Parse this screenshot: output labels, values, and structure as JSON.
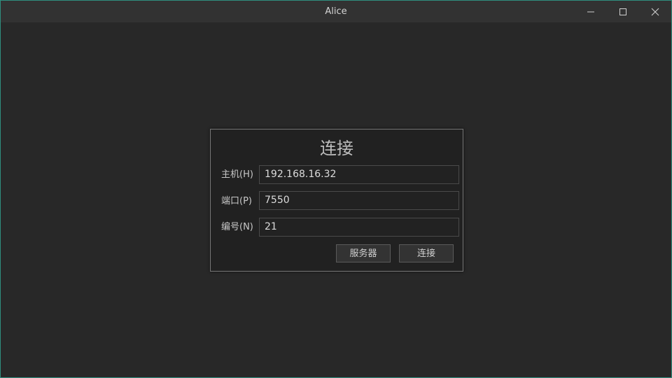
{
  "window": {
    "title": "Alice",
    "accent_border_color": "#2f8f7f",
    "controls": {
      "minimize_icon": "minimize-icon",
      "maximize_icon": "maximize-icon",
      "close_icon": "close-icon"
    }
  },
  "dialog": {
    "title": "连接",
    "fields": {
      "host": {
        "label": "主机(H)",
        "value": "192.168.16.32"
      },
      "port": {
        "label": "端口(P)",
        "value": "7550"
      },
      "id": {
        "label": "编号(N)",
        "value": "21"
      }
    },
    "buttons": {
      "server_label": "服务器",
      "connect_label": "连接"
    }
  }
}
